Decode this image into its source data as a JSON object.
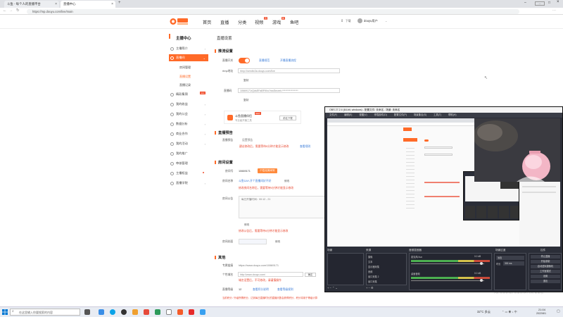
{
  "browser": {
    "tabs": [
      {
        "title": "斗鱼 - 每个人的直播平台"
      },
      {
        "title": "直播中心"
      }
    ],
    "url": "https://mp.douyu.com/live/main"
  },
  "site": {
    "nav": [
      "首页",
      "直播",
      "分类",
      "视频",
      "游戏",
      "鱼吧"
    ],
    "nav_badges": {
      "video": "直",
      "game": "新"
    },
    "download_label": "下载",
    "username": "douyu用户",
    "accent_color": "#ff6a28"
  },
  "sidebar": {
    "title": "主播中心",
    "items": [
      {
        "label": "主播简介"
      },
      {
        "label": "直播间"
      },
      {
        "label": "精彩集锦",
        "badge": "new"
      },
      {
        "label": "我的收益"
      },
      {
        "label": "我的公会"
      },
      {
        "label": "数据分析"
      },
      {
        "label": "商业合作"
      },
      {
        "label": "我的活动"
      },
      {
        "label": "我的推广"
      },
      {
        "label": "审核管理"
      },
      {
        "label": "主播权益"
      },
      {
        "label": "直播学院"
      }
    ],
    "subitems": [
      "房间管理",
      "直播设置",
      "直播记录"
    ]
  },
  "main": {
    "page_title": "直播设置",
    "push": {
      "title": "推流设置",
      "switch_label": "直播开关",
      "link1": "直播规范",
      "link2": "开播直播流程",
      "rtmp_label": "rtmp地址",
      "rtmp_value": "rtmp://sendtc3a.douyu.com/live",
      "copy": "复制",
      "key_label": "直播码",
      "key_value": "10669171rQdsEFaBFKho?wsSecret=****************",
      "promo_title": "斗鱼直播伴侣",
      "promo_sub": "专业级开播工具",
      "promo_btn": "前往下载"
    },
    "preview": {
      "title": "直播预告",
      "label": "直播预告",
      "status": "设置预告",
      "warn": "建议修改后，需要等待5分钟才能显示修改",
      "link": "查看规则"
    },
    "room": {
      "title": "房间设置",
      "room_id_label": "房间号",
      "room_id": "10669171",
      "room_id_btn": "个性化房间号",
      "name_label": "房间名称",
      "name_value": "斗鱼DAY-开个直播间好不好",
      "name_btn": "修改",
      "name_warn": "修改房间名称后，需要等待5分钟才能显示修改",
      "notice_label": "房间公告",
      "notice_placeholder": "每日开播时间：00:12 - 21",
      "notice_btn": "修改",
      "notice_warn": "修改公告后，需要等待5分钟才能显示修改",
      "cover_label": "房间封面",
      "cover_btn": "修改"
    },
    "other": {
      "title": "其他",
      "link_label": "专属链接",
      "link_value": "https://www.douyu.com/10669171",
      "short_label": "个性域名",
      "short_value": "http://www.douyu.com/",
      "short_btn": "确定",
      "short_warn": "域名设置后，不可修改，请谨慎操作",
      "level_label": "直播等级",
      "level_value": "12",
      "level_link1": "查看积分说明",
      "level_link2": "查看等级规则",
      "bottom_warn": "当前积分 / 升级所需积分，达到每日直播时长的直播天数会获得积分，积分将用于等级计算"
    }
  },
  "obs": {
    "title": "OBS 27.2.4 (64-bit, windows) - 配置文件: 未命名 - 场景: 未命名",
    "menu": [
      "文件(F)",
      "编辑(E)",
      "视图(V)",
      "停靠部件(D)",
      "配置文件(P)",
      "场景集合(S)",
      "工具(T)",
      "帮助(H)"
    ],
    "docks": {
      "scenes": "场景",
      "sources": "来源",
      "mixer": "音频混音器",
      "transitions": "场景过渡",
      "controls": "控件"
    },
    "sources": [
      "摄像",
      "文本",
      "显示器采集",
      "音频",
      "窗口采集 2",
      "窗口采集"
    ],
    "mixer": [
      {
        "name": "麦克风/Aux",
        "db": "0.0 dB"
      },
      {
        "name": "桌面音频",
        "db": "0.0 dB"
      }
    ],
    "transition_type": "淡出",
    "transition_duration_label": "时长",
    "transition_duration": "300 ms",
    "controls": [
      "停止直播",
      "开始录制",
      "启动虚拟摄像机",
      "工作室模式",
      "设置",
      "退出"
    ],
    "status": "LIVE: 00:49:36   REC: 00:00:00   CPU: 3.4%, 60.00 fps"
  },
  "taskbar": {
    "search_placeholder": "在这里输入你要搜索的内容",
    "weather": "32°C 多云",
    "time": "21:04",
    "date": "2022/8/1"
  }
}
